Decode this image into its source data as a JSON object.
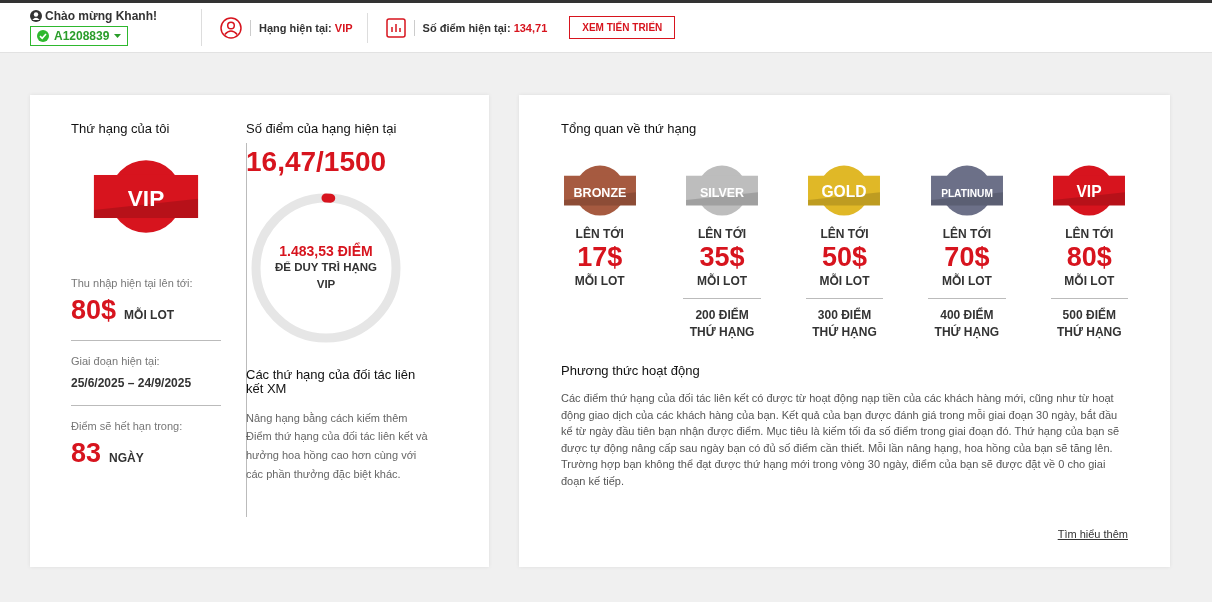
{
  "header": {
    "greeting": "Chào mừng Khanh!",
    "account": "A1208839",
    "account_verified": true,
    "rank_label": "Hạng hiện tại:",
    "rank_value": "VIP",
    "points_label": "Số điểm hiện tại:",
    "points_value": "134,71",
    "progress_button": "XEM TIẾN TRIỂN"
  },
  "my_rank": {
    "title": "Thứ hạng của tôi",
    "badge": {
      "label": "VIP",
      "color": "#d7141e"
    },
    "stats": [
      {
        "label": "Thu nhập hiện tại lên tới:",
        "kind": "big",
        "value": "80$",
        "unit": "MỖI LOT"
      },
      {
        "label": "Giai đoạn hiện tại:",
        "kind": "text",
        "value": "25/6/2025 – 24/9/2025"
      },
      {
        "label": "Điểm sẽ hết hạn trong:",
        "kind": "big",
        "value": "83",
        "unit": "NGÀY"
      }
    ]
  },
  "current_points": {
    "title": "Số điểm của hạng hiện tại",
    "value": "16,47/1500",
    "level": 0.011,
    "remaining": "1.483,53 ĐIỂM",
    "remaining_caption": "ĐỂ DUY TRÌ HẠNG VIP",
    "partner_title": "Các thứ hạng của đối tác liên kết XM",
    "partner_text": "Nâng hạng bằng cách kiếm thêm Điểm thứ hạng của đối tác liên kết và hưởng hoa hồng cao hơn cùng với các phần thưởng đặc biệt khác."
  },
  "overview": {
    "title": "Tổng quan về thứ hạng",
    "tiers": [
      {
        "label": "BRONZE",
        "color": "#a65a40",
        "up_to": "LÊN TỚI",
        "amount": "17$",
        "per": "MỖI LOT"
      },
      {
        "label": "SILVER",
        "color": "#bdbdbd",
        "up_to": "LÊN TỚI",
        "amount": "35$",
        "per": "MỖI LOT",
        "requirement": "200 ĐIỂM THỨ HẠNG"
      },
      {
        "label": "GOLD",
        "color": "#e0b827",
        "up_to": "LÊN TỚI",
        "amount": "50$",
        "per": "MỖI LOT",
        "requirement": "300 ĐIỂM THỨ HẠNG"
      },
      {
        "label": "PLATINUM",
        "color": "#6c7088",
        "up_to": "LÊN TỚI",
        "amount": "70$",
        "per": "MỖI LOT",
        "requirement": "400 ĐIỂM THỨ HẠNG"
      },
      {
        "label": "VIP",
        "color": "#d7141e",
        "up_to": "LÊN TỚI",
        "amount": "80$",
        "per": "MỖI LOT",
        "requirement": "500 ĐIỂM THỨ HẠNG"
      }
    ],
    "how_title": "Phương thức hoạt động",
    "how_text": "Các điểm thứ hạng của đối tác liên kết có được từ hoạt động nạp tiền của các khách hàng mới, cũng như từ hoạt động giao dịch của các khách hàng của bạn. Kết quả của bạn được đánh giá trong mỗi giai đoạn 30 ngày, bắt đầu kể từ ngày đầu tiên bạn nhận được điểm. Mục tiêu là kiếm tối đa số điểm trong giai đoạn đó. Thứ hạng của bạn sẽ được tự động nâng cấp sau ngày bạn có đủ số điểm cần thiết. Mỗi lần nâng hạng, hoa hồng của bạn sẽ tăng lên. Trường hợp bạn không thể đạt được thứ hạng mới trong vòng 30 ngày, điểm của bạn sẽ được đặt về 0 cho giai đoạn kế tiếp.",
    "learn_more": "Tìm hiểu thêm"
  }
}
